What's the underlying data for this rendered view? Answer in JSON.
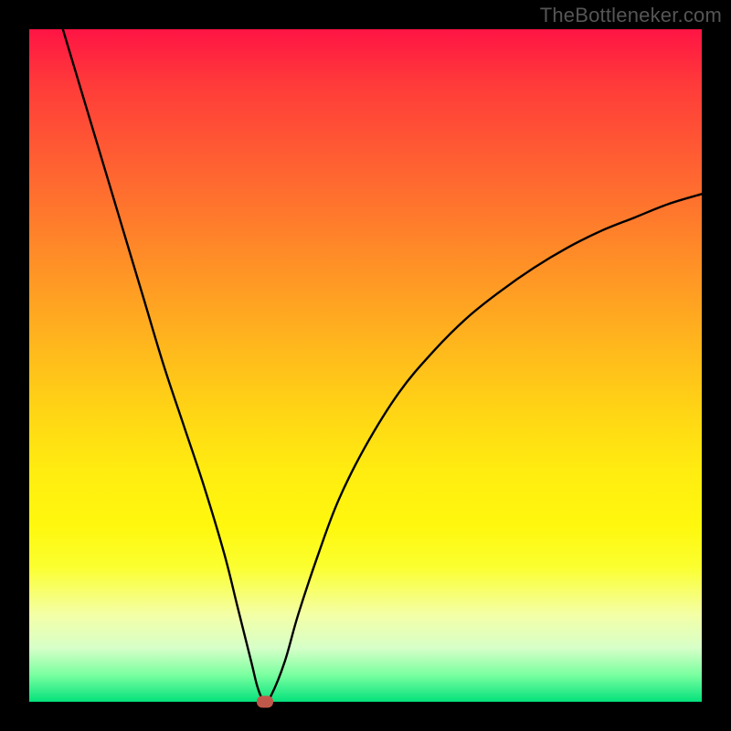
{
  "watermark": "TheBottleneker.com",
  "chart_data": {
    "type": "line",
    "title": "",
    "xlabel": "",
    "ylabel": "",
    "xlim": [
      0,
      100
    ],
    "ylim": [
      0,
      100
    ],
    "series": [
      {
        "name": "curve",
        "x": [
          5,
          8,
          11,
          14,
          17,
          20,
          23,
          26,
          29,
          31,
          33,
          34,
          35,
          36,
          38,
          40,
          43,
          46,
          50,
          55,
          60,
          65,
          70,
          75,
          80,
          85,
          90,
          95,
          100
        ],
        "y": [
          100,
          90,
          80,
          70,
          60,
          50,
          41,
          32,
          22,
          14,
          6,
          2,
          0,
          1,
          6,
          13,
          22,
          30,
          38,
          46,
          52,
          57,
          61,
          64.5,
          67.5,
          70,
          72,
          74,
          75.5
        ]
      }
    ],
    "marker": {
      "x": 35,
      "y": 0
    },
    "gradient_stops": [
      {
        "pct": 0,
        "color": "#ff1444"
      },
      {
        "pct": 50,
        "color": "#ffd814"
      },
      {
        "pct": 100,
        "color": "#04e27c"
      }
    ]
  }
}
